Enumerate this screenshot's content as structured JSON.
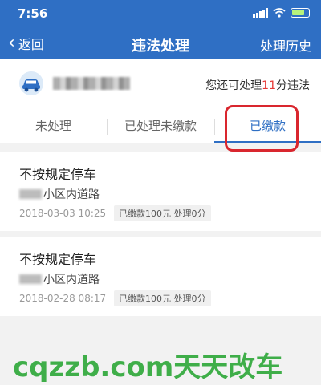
{
  "status_bar": {
    "time": "7:56"
  },
  "nav": {
    "back_label": "返回",
    "title": "违法处理",
    "history_label": "处理历史"
  },
  "vehicle": {
    "quota_prefix": "您还可处理",
    "quota_number": "11",
    "quota_suffix": "分违法"
  },
  "tabs": [
    {
      "label": "未处理"
    },
    {
      "label": "已处理未缴款"
    },
    {
      "label": "已缴款"
    }
  ],
  "records": [
    {
      "title": "不按规定停车",
      "location": "小区内道路",
      "time": "2018-03-03 10:25",
      "status": "已缴款100元 处理0分"
    },
    {
      "title": "不按规定停车",
      "location": "小区内道路",
      "time": "2018-02-28 08:17",
      "status": "已缴款100元 处理0分"
    }
  ],
  "watermark": "cqzzb.com天天改车",
  "colors": {
    "primary": "#2f6fc4",
    "highlight": "#d9262e",
    "quota_number": "#e53935",
    "watermark": "#3fae49"
  }
}
